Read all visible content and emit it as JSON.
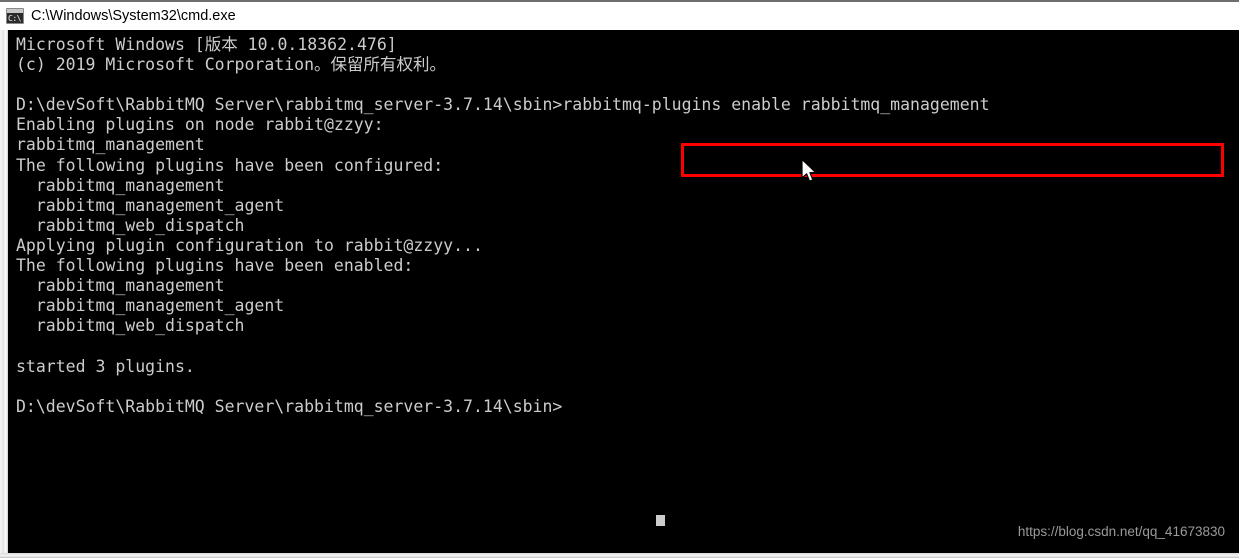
{
  "window": {
    "title": "C:\\Windows\\System32\\cmd.exe",
    "icon": "cmd-console-icon",
    "icon_glyph": "C:\\",
    "background_color": "#000000",
    "text_color": "#cccccc"
  },
  "terminal": {
    "lines": [
      "Microsoft Windows [版本 10.0.18362.476]",
      "(c) 2019 Microsoft Corporation。保留所有权利。",
      "",
      "D:\\devSoft\\RabbitMQ Server\\rabbitmq_server-3.7.14\\sbin>rabbitmq-plugins enable rabbitmq_management",
      "Enabling plugins on node rabbit@zzyy:",
      "rabbitmq_management",
      "The following plugins have been configured:",
      "  rabbitmq_management",
      "  rabbitmq_management_agent",
      "  rabbitmq_web_dispatch",
      "Applying plugin configuration to rabbit@zzyy...",
      "The following plugins have been enabled:",
      "  rabbitmq_management",
      "  rabbitmq_management_agent",
      "  rabbitmq_web_dispatch",
      "",
      "started 3 plugins.",
      "",
      "D:\\devSoft\\RabbitMQ Server\\rabbitmq_server-3.7.14\\sbin>"
    ],
    "prompt_path": "D:\\devSoft\\RabbitMQ Server\\rabbitmq_server-3.7.14\\sbin>",
    "typed_command": "rabbitmq-plugins enable rabbitmq_management",
    "node_name": "rabbit@zzyy",
    "plugins_configured": [
      "rabbitmq_management",
      "rabbitmq_management_agent",
      "rabbitmq_web_dispatch"
    ],
    "plugins_enabled": [
      "rabbitmq_management",
      "rabbitmq_management_agent",
      "rabbitmq_web_dispatch"
    ],
    "started_count": 3,
    "started_message": "started 3 plugins."
  },
  "annotation": {
    "red_box_color": "#ff0000",
    "highlighted_text": "rabbitmq-plugins enable rabbitmq_management"
  },
  "watermark": {
    "text": "https://blog.csdn.net/qq_41673830",
    "color": "#9a9a9a"
  }
}
